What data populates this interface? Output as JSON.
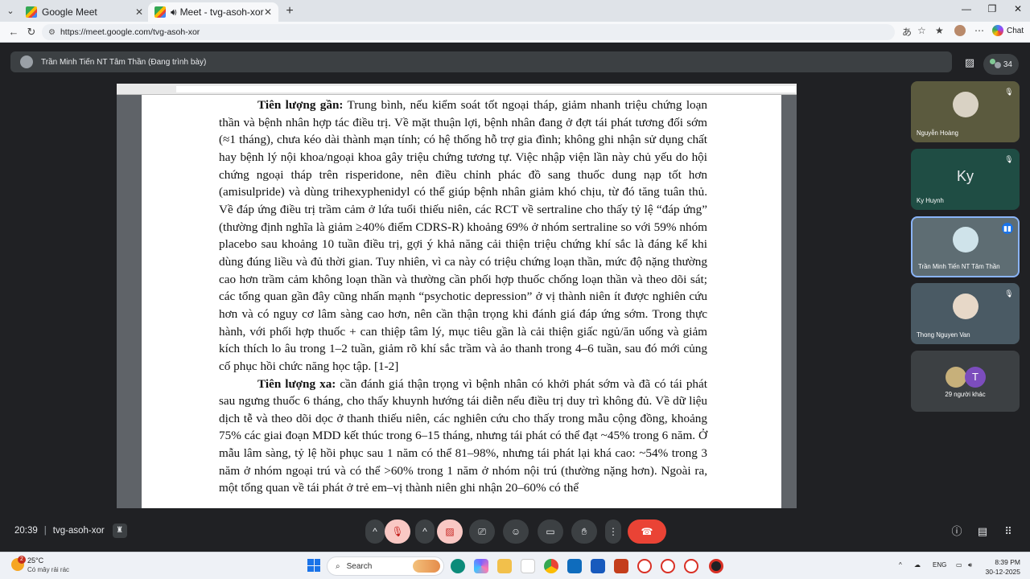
{
  "browser": {
    "tabs": [
      {
        "title": "Google Meet",
        "active": false
      },
      {
        "title": "Meet - tvg-asoh-xor",
        "active": true
      }
    ],
    "url": "https://meet.google.com/tvg-asoh-xor",
    "chat_label": "Chat"
  },
  "meet": {
    "presenter_label": "Trần Minh Tiến NT Tâm Thần (Đang trình bày)",
    "participant_count": "34",
    "time": "20:39",
    "meeting_code": "tvg-asoh-xor",
    "participants": [
      {
        "name": "Nguyễn Hoàng",
        "muted": true,
        "bg": "#5b5a3e",
        "avatar_color": "#d9d2c4"
      },
      {
        "name": "Ky Huynh",
        "initials": "Ky",
        "muted": true,
        "bg": "#1f4d44"
      },
      {
        "name": "Trần Minh Tiến NT Tâm Thần",
        "speaking": true,
        "bg": "#5e6d73",
        "avatar_color": "#cfe3ea"
      },
      {
        "name": "Thong Nguyen Van",
        "muted": true,
        "bg": "#4a5a64",
        "avatar_color": "#e7d8c8"
      },
      {
        "name": "29 người khác",
        "second_initial": "T",
        "bg": "#3c4043"
      }
    ]
  },
  "document": {
    "paragraph1_label": "Tiên lượng gần:",
    "paragraph1_text": " Trung bình, nếu kiểm soát tốt ngoại tháp, giảm nhanh triệu chứng loạn thần và bệnh nhân hợp tác điều trị. Về mặt thuận lợi, bệnh nhân đang ở đợt tái phát tương đối sớm (≈1 tháng), chưa kéo dài thành mạn tính; có hệ thống hỗ trợ gia đình; không ghi nhận sử dụng chất hay bệnh lý nội khoa/ngoại khoa gây triệu chứng tương tự. Việc nhập viện lần này chủ yếu do hội chứng ngoại tháp trên risperidone, nên điều chỉnh phác đồ sang thuốc dung nạp tốt hơn (amisulpride) và dùng trihexyphenidyl có thể giúp bệnh nhân giảm khó chịu, từ đó tăng tuân thủ. Về đáp ứng điều trị trầm cảm ở lứa tuổi thiếu niên, các RCT về sertraline cho thấy tỷ lệ “đáp ứng” (thường định nghĩa là giảm ≥40% điểm CDRS-R) khoảng 69% ở nhóm sertraline so với 59% nhóm placebo sau khoảng 10 tuần điều trị, gợi ý khả năng cải thiện triệu chứng khí sắc là đáng kể khi dùng đúng liều và đủ thời gian.  Tuy nhiên, vì ca này có triệu chứng loạn thần, mức độ nặng thường cao hơn trầm cảm không loạn thần và thường cần phối hợp thuốc chống loạn thần và theo dõi sát; các tổng quan gần đây cũng nhấn mạnh “psychotic depression” ở vị thành niên ít được nghiên cứu hơn và có nguy cơ lâm sàng cao hơn, nên cần thận trọng khi đánh giá đáp ứng sớm.  Trong thực hành, với phối hợp thuốc + can thiệp tâm lý, mục tiêu gần là cải thiện giấc ngủ/ăn uống và giảm kích thích lo âu trong 1–2 tuần, giảm rõ khí sắc trầm và ảo thanh trong 4–6 tuần, sau đó mới củng cố phục hồi chức năng học tập. [1-2]",
    "paragraph2_label": "Tiên lượng xa:",
    "paragraph2_text": " cần đánh giá thận trọng vì bệnh nhân có khởi phát sớm và đã có tái phát sau ngưng thuốc 6 tháng, cho thấy khuynh hướng tái diễn nếu điều trị duy trì không đủ. Về dữ liệu dịch tễ và theo dõi dọc ở thanh thiếu niên, các nghiên cứu cho thấy trong mẫu cộng đồng, khoảng 75% các giai đoạn MDD kết thúc trong 6–15 tháng, nhưng tái phát có thể đạt ~45% trong 6 năm. Ở mẫu lâm sàng, tỷ lệ hồi phục sau 1 năm có thể 81–98%, nhưng tái phát lại khá cao: ~54% trong 3 năm ở nhóm ngoại trú và có thể >60% trong 1 năm ở nhóm nội trú (thường nặng hơn).  Ngoài ra, một tổng quan về tái phát ở trẻ em–vị thành niên ghi nhận 20–60% có thể"
  },
  "taskbar": {
    "weather_temp": "25°C",
    "weather_cond": "Có mây rải rác",
    "weather_badge": "2",
    "search_label": "Search",
    "lang": "ENG",
    "time": "8:39 PM",
    "date": "30-12-2025"
  }
}
